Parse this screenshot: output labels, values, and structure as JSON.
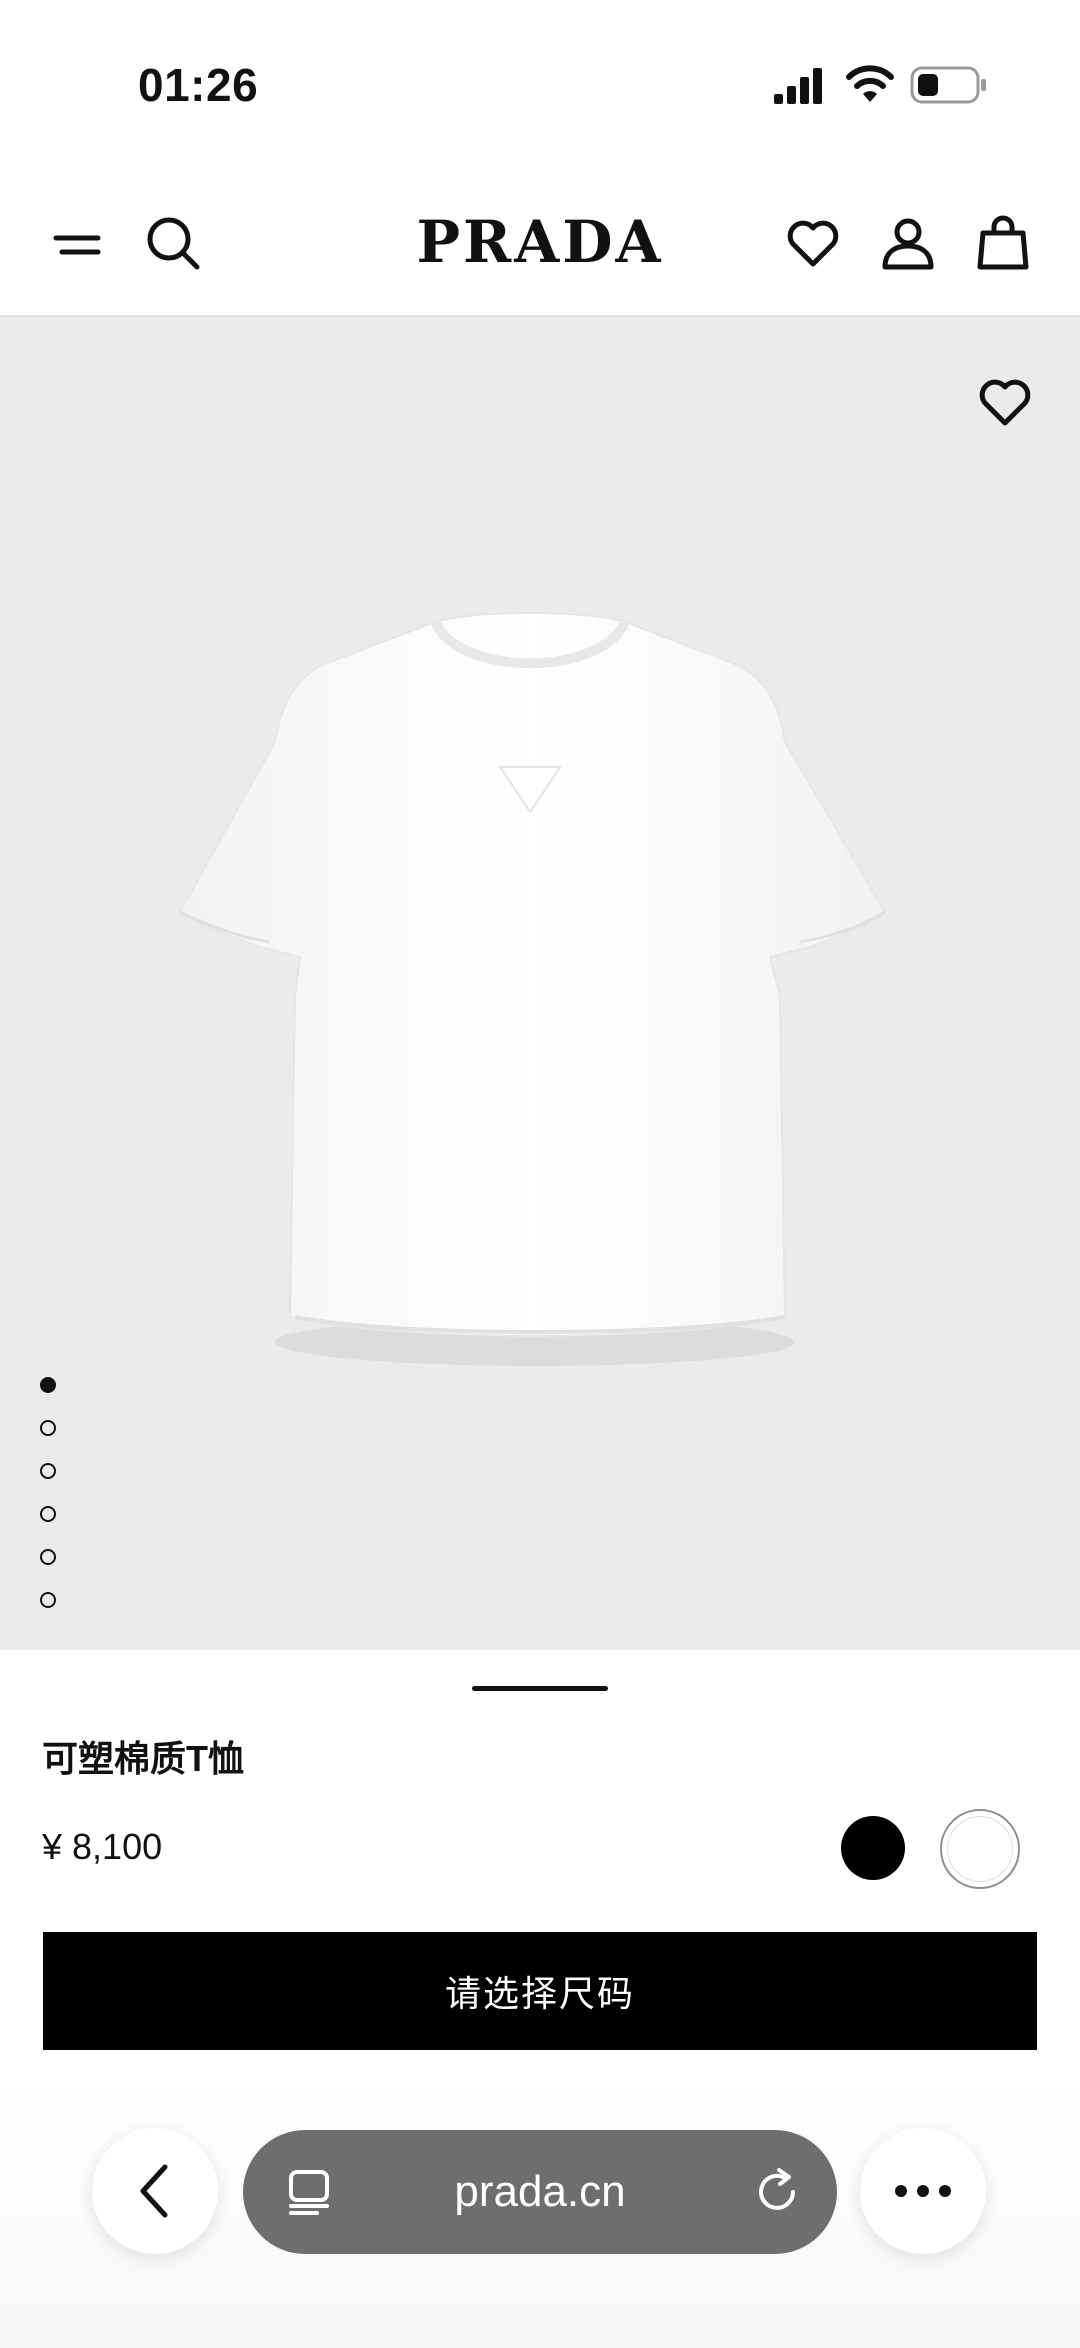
{
  "status_bar": {
    "time": "01:26",
    "icons": [
      "signal-icon",
      "wifi-icon",
      "battery-icon"
    ]
  },
  "header": {
    "logo": "PRADA",
    "icons": [
      "menu-icon",
      "search-icon",
      "heart-icon",
      "user-icon",
      "shopping-bag-icon"
    ]
  },
  "gallery": {
    "image": "white-tshirt-product-photo",
    "total_slides": 6,
    "active_slide": 1
  },
  "product": {
    "name": "可塑棉质T恤",
    "price": "¥ 8,100",
    "colors": [
      {
        "name": "black",
        "hex": "#000000",
        "selected": false
      },
      {
        "name": "white",
        "hex": "#ffffff",
        "selected": true
      }
    ],
    "cta_label": "请选择尺码"
  },
  "browser": {
    "url": "prada.cn",
    "icons": [
      "back-icon",
      "tabs-icon",
      "reload-icon",
      "more-icon"
    ]
  },
  "colors": {
    "gallery_background": "#ebebeb",
    "cta_background": "#000000",
    "address_bar": "#6e6e6e"
  }
}
